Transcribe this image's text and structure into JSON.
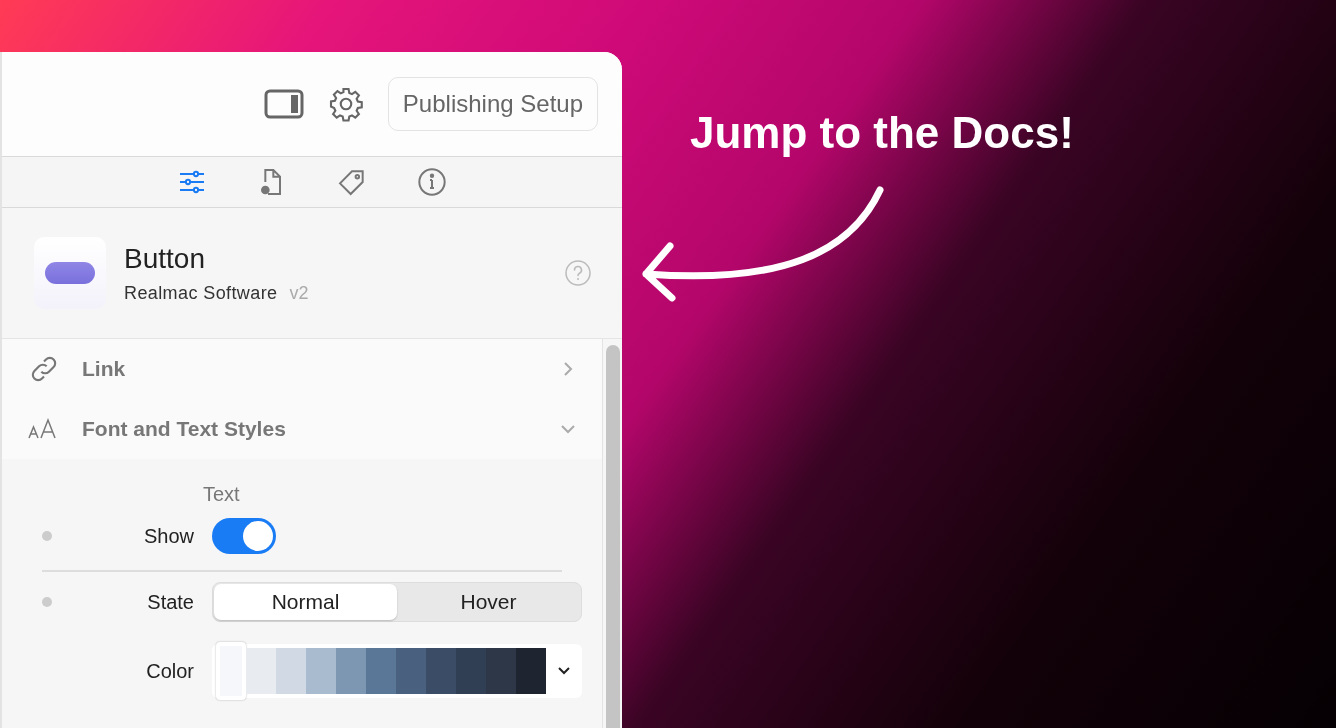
{
  "toolbar": {
    "publish_button": "Publishing Setup"
  },
  "tabs": [
    {
      "kind": "sliders",
      "selected": true
    },
    {
      "kind": "file",
      "selected": false
    },
    {
      "kind": "tag",
      "selected": false
    },
    {
      "kind": "info",
      "selected": false
    }
  ],
  "component": {
    "title": "Button",
    "vendor": "Realmac Software",
    "version": "v2"
  },
  "sections": [
    {
      "kind": "link",
      "title": "Link",
      "expanded": false
    },
    {
      "kind": "font",
      "title": "Font and Text Styles",
      "expanded": true
    }
  ],
  "text_group": {
    "heading": "Text",
    "show": {
      "label": "Show",
      "on": true
    },
    "state": {
      "label": "State",
      "options": [
        {
          "label": "Normal",
          "selected": true
        },
        {
          "label": "Hover",
          "selected": false
        }
      ]
    },
    "color": {
      "label": "Color",
      "swatches": [
        {
          "color": "#f5f7fa",
          "selected": true
        },
        {
          "color": "#e8ecf1",
          "selected": false
        },
        {
          "color": "#d1dae4",
          "selected": false
        },
        {
          "color": "#a9bbce",
          "selected": false
        },
        {
          "color": "#7d96b1",
          "selected": false
        },
        {
          "color": "#5b7797",
          "selected": false
        },
        {
          "color": "#4a607f",
          "selected": false
        },
        {
          "color": "#3b4d66",
          "selected": false
        },
        {
          "color": "#313f55",
          "selected": false
        },
        {
          "color": "#2d3748",
          "selected": false
        },
        {
          "color": "#1f2530",
          "selected": false
        }
      ]
    }
  },
  "annotation": "Jump to the Docs!"
}
